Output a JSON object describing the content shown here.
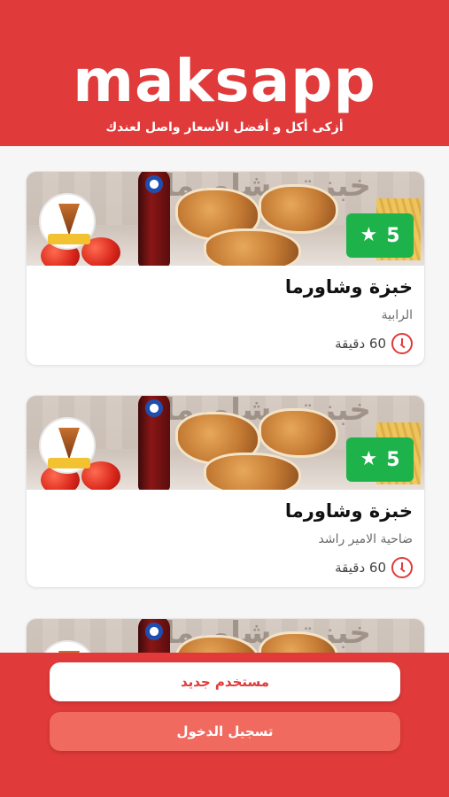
{
  "header": {
    "logo_text": "maksapp",
    "tagline": "أزكى أكل و أفضل الأسعار واصل لعندك"
  },
  "restaurants": [
    {
      "banner_text": "خبزة وشاورما",
      "rating": "5",
      "name": "خبزة وشاورما",
      "area": "الرابية",
      "delivery_time": "60 دقيقة"
    },
    {
      "banner_text": "خبزة وشاورما",
      "rating": "5",
      "name": "خبزة وشاورما",
      "area": "ضاحية الامير راشد",
      "delivery_time": "60 دقيقة"
    },
    {
      "banner_text": "خبزة وشاورما"
    }
  ],
  "footer": {
    "register_label": "مستخدم جديد",
    "login_label": "تسجيل الدخول"
  },
  "icons": {
    "rating": "star-icon",
    "time": "clock-icon"
  },
  "colors": {
    "brand_red": "#e03a3a",
    "rating_green": "#1db34a",
    "login_button": "#f06a5f"
  }
}
